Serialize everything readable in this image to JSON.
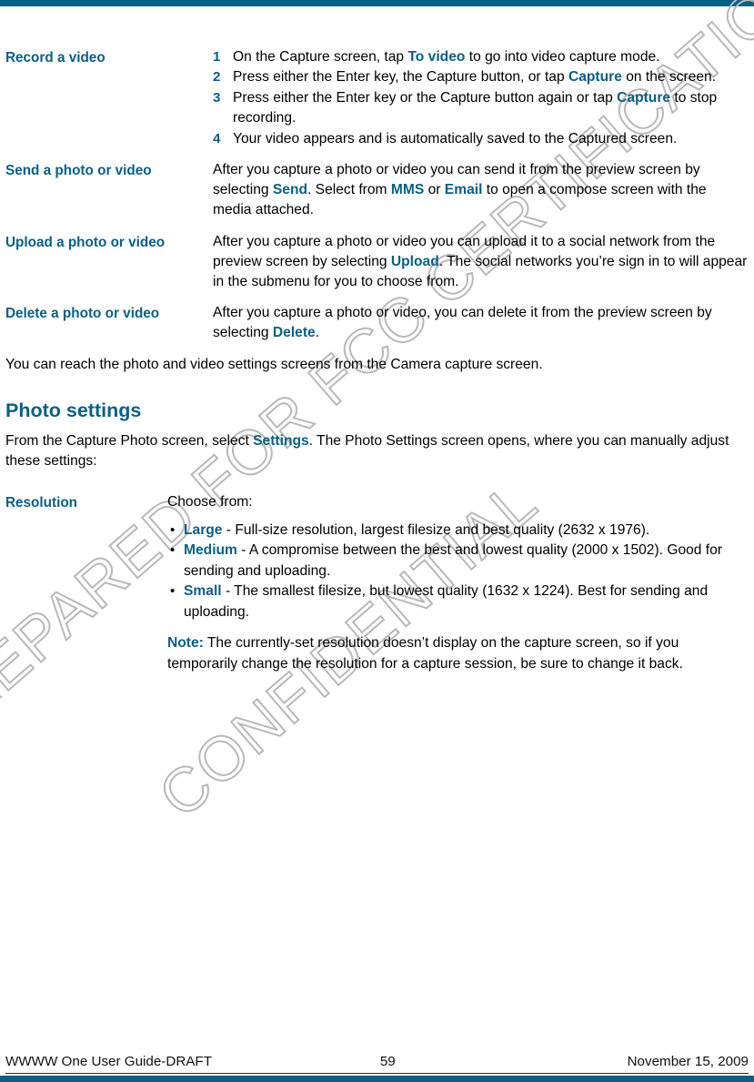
{
  "page": {
    "accent_color": "#0a5f85",
    "watermark_color": "#b9b9b9",
    "watermark_line1": "PREPARED FOR FCC CERTIFICATION",
    "watermark_line2": "CONFIDENTIAL"
  },
  "sections": {
    "record_video": {
      "term": "Record a video",
      "steps": [
        {
          "num": "1",
          "pre": "On the Capture screen, tap ",
          "kw": "To video",
          "post": " to go into video capture mode."
        },
        {
          "num": "2",
          "pre": "Press either the Enter key, the Capture button, or tap ",
          "kw": "Capture",
          "post": " on the screen."
        },
        {
          "num": "3",
          "pre": "Press either the Enter key or the Capture button again or tap ",
          "kw": "Capture",
          "post": " to stop recording."
        },
        {
          "num": "4",
          "pre": "Your video appears and is automatically saved to the Captured screen.",
          "kw": "",
          "post": ""
        }
      ]
    },
    "send": {
      "term": "Send a photo or video",
      "p1": "After you capture a photo or video you can send it from the preview screen by selecting ",
      "kw1": "Send",
      "p2": ". Select from ",
      "kw2": "MMS",
      "p3": " or ",
      "kw3": "Email",
      "p4": " to open a compose screen with the media attached."
    },
    "upload": {
      "term": "Upload a photo or video",
      "p1": "After you capture a photo or video you can upload it to a social network from the preview screen by selecting ",
      "kw1": "Upload",
      "p2": ". The social networks you’re sign in to will appear in the submenu for you to choose from."
    },
    "delete": {
      "term": "Delete a photo or video",
      "p1": "After you capture a photo or video, you can delete it from the preview screen by selecting ",
      "kw1": "Delete",
      "p2": "."
    },
    "lead_paragraph": "You can reach the photo and video settings screens from the Camera capture screen.",
    "photo_settings": {
      "heading": "Photo settings",
      "intro_p1": "From the Capture Photo screen, select ",
      "intro_kw": "Settings",
      "intro_p2": ". The Photo Settings screen opens, where you can manually adjust these settings:",
      "resolution": {
        "term": "Resolution",
        "choose_label": "Choose from:",
        "options": [
          {
            "name": "Large",
            "desc": " - Full-size resolution, largest filesize and best quality (2632 x 1976)."
          },
          {
            "name": "Medium",
            "desc": " - A compromise between the best and lowest quality (2000 x 1502). Good for sending and uploading."
          },
          {
            "name": "Small",
            "desc": " - The smallest filesize, but lowest quality (1632 x 1224). Best for sending and uploading."
          }
        ],
        "note_label": "Note:",
        "note_text": " The currently-set resolution doesn’t display on the capture screen, so if you temporarily change the resolution for a capture session, be sure to change it back."
      }
    }
  },
  "footer": {
    "left": "WWWW One User Guide-DRAFT",
    "page_number": "59",
    "right": "November 15, 2009"
  }
}
